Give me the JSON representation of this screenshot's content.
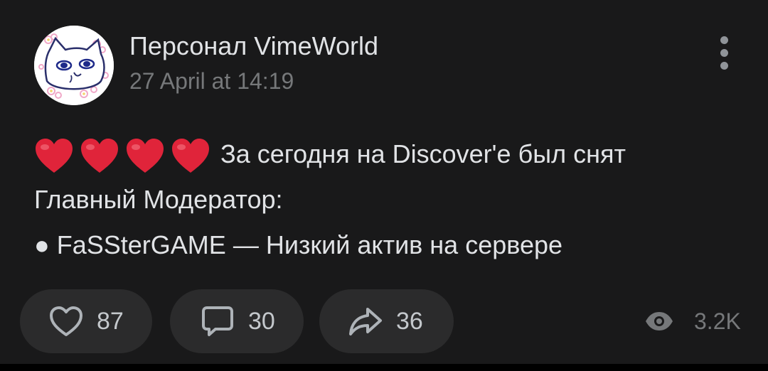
{
  "post": {
    "author": "Персонал VimeWorld",
    "date": "27 April at 14:19",
    "text_line1": "За сегодня на Discover'e был снят",
    "text_line2": "Главный Модератор:",
    "bullet": "●",
    "text_line3": "FaSSterGAME — Низкий актив на сервере"
  },
  "actions": {
    "likes": "87",
    "comments": "30",
    "shares": "36",
    "views": "3.2K"
  },
  "icons": {
    "menu": "more-vertical-icon",
    "heart_emoji": "red-heart-emoji",
    "like": "heart-outline-icon",
    "comment": "comment-bubble-icon",
    "share": "share-arrow-icon",
    "views": "eye-icon"
  },
  "colors": {
    "background": "#19191a",
    "text": "#e1e3e6",
    "secondary_text": "#76787a",
    "pill": "#2b2b2c",
    "heart": "#e0243a"
  }
}
